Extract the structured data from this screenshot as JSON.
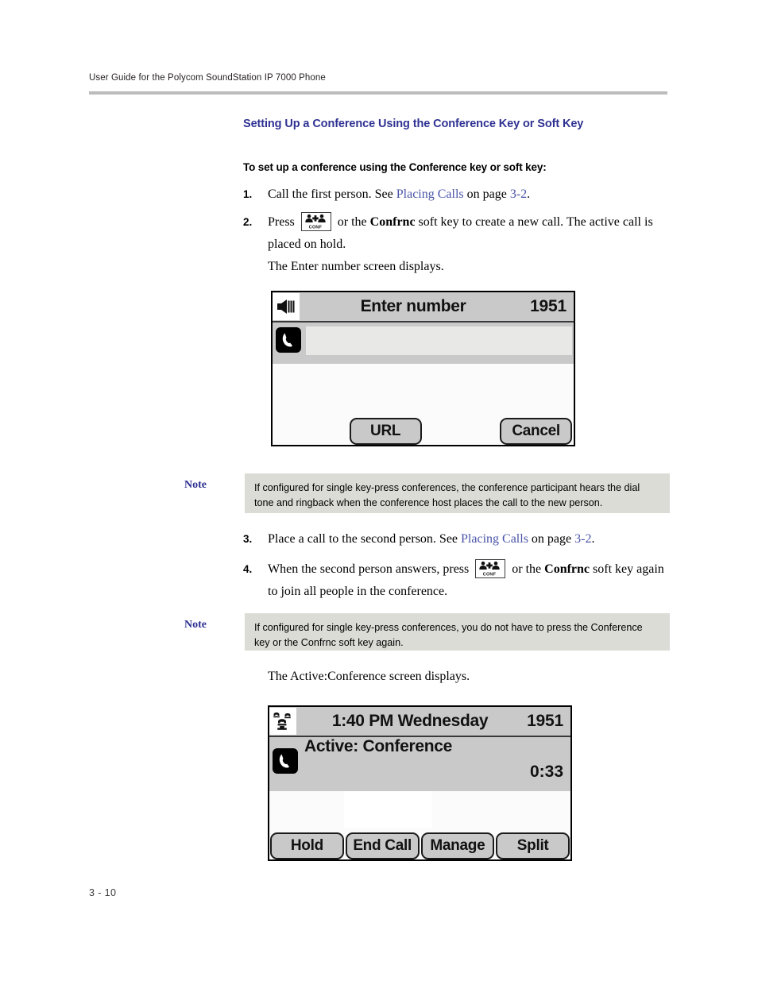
{
  "header": {
    "running_title": "User Guide for the Polycom SoundStation IP 7000 Phone"
  },
  "section": {
    "heading": "Setting Up a Conference Using the Conference Key or Soft Key",
    "heading_color": "#2e3192"
  },
  "procedure": {
    "title": "To set up a conference using the Conference key or soft key:",
    "steps": [
      {
        "number": "1.",
        "text_before": "Call the first person. See ",
        "link1": "Placing Calls",
        "text_mid": " on page ",
        "link2": "3-2",
        "text_after": "."
      },
      {
        "number": "2.",
        "text_before": "Press ",
        "icon": "conference-key-icon",
        "text_mid": " or the ",
        "bold": "Confrnc",
        "text_after": " soft key to create a new call. The active call is placed on hold.",
        "sub_text": "The Enter number screen displays."
      },
      {
        "number": "3.",
        "text_before": "Place a call to the second person. See ",
        "link1": "Placing Calls",
        "text_mid": " on page ",
        "link2": "3-2",
        "text_after": "."
      },
      {
        "number": "4.",
        "text_before": "When the second person answers, press ",
        "icon": "conference-key-icon",
        "text_mid": " or the ",
        "bold": "Confrnc",
        "text_after": " soft key again to join all people in the conference."
      }
    ]
  },
  "conference_key": {
    "label": "CONF"
  },
  "notes": [
    {
      "label": "Note",
      "text": "If configured for single key-press conferences, the conference participant hears the dial tone and ringback when the conference host places the call to the new person."
    },
    {
      "label": "Note",
      "text": "If configured for single key-press conferences, you do not have to press the Conference key or the Confrnc soft key again."
    }
  ],
  "paragraphs": {
    "active_conf_intro": "The Active:Conference screen displays."
  },
  "screen_enter_number": {
    "status_icon": "speaker-volume-icon",
    "title": "Enter number",
    "extension": "1951",
    "line_icon": "handset-icon",
    "input_value": "",
    "softkeys": [
      "",
      "URL",
      "",
      "Cancel"
    ]
  },
  "screen_active_conference": {
    "status_icon": "conference-phones-icon",
    "title": "1:40  PM Wednesday",
    "extension": "1951",
    "line_icon": "handset-icon",
    "call_label": "Active: Conference",
    "call_timer": "0:33",
    "softkeys": [
      "Hold",
      "End Call",
      "Manage",
      "Split"
    ]
  },
  "footer": {
    "page_number": "3 - 10"
  }
}
